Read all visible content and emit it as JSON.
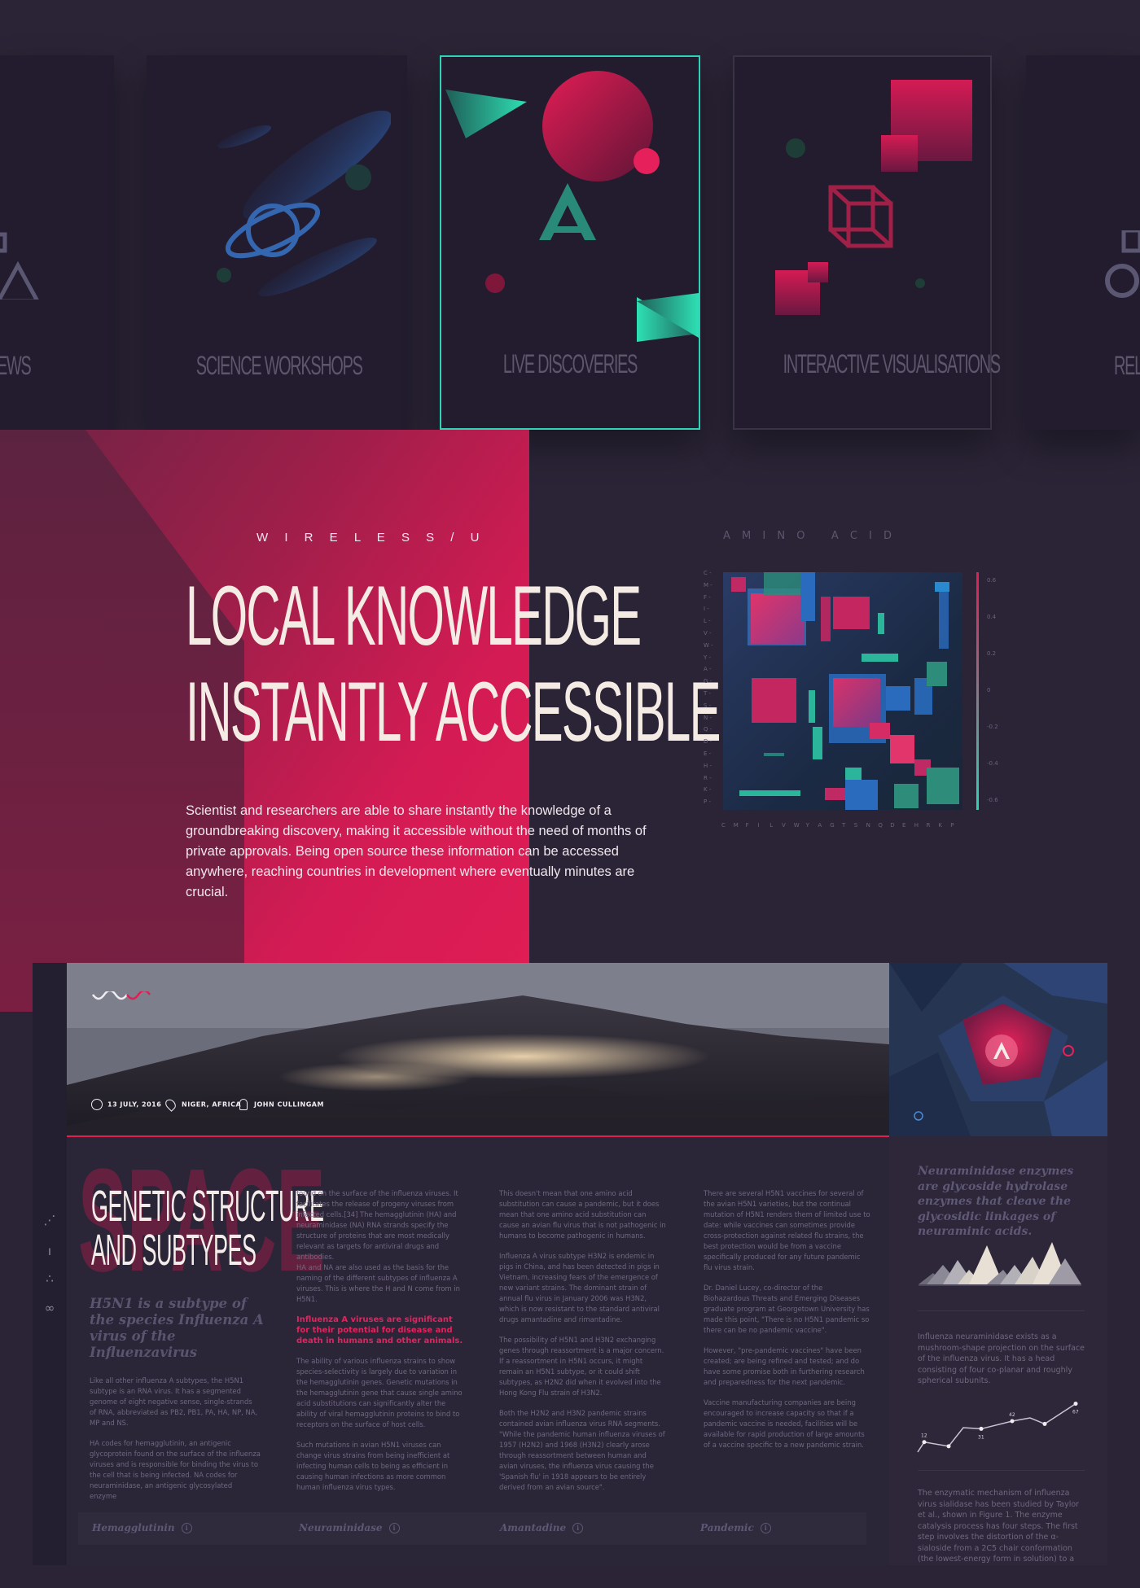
{
  "cards": [
    {
      "label": "EWS"
    },
    {
      "label": "SCIENCE WORKSHOPS"
    },
    {
      "label": "LIVE DISCOVERIES"
    },
    {
      "label": "INTERACTIVE VISUALISATIONS"
    },
    {
      "label": "REL"
    }
  ],
  "hero": {
    "eyebrow": "W I R E L E S S / U",
    "headline_line1": "LOCAL KNOWLEDGE",
    "headline_line2": "INSTANTLY ACCESSIBLE",
    "body": "Scientist and researchers are able to share instantly the knowledge of a groundbreaking discovery, making it accessible without the need of months of private approvals. Being open source these information can be accessed anywhere, reaching countries in development where eventually minutes are crucial."
  },
  "amino": {
    "title": "A M I N O   A C I D",
    "y_letters": [
      "C",
      "M",
      "F",
      "I",
      "L",
      "V",
      "W",
      "Y",
      "A",
      "G",
      "T",
      "S",
      "N",
      "Q",
      "D",
      "E",
      "H",
      "R",
      "K",
      "P"
    ],
    "x_letters": [
      "C",
      "M",
      "F",
      "I",
      "L",
      "V",
      "W",
      "Y",
      "A",
      "G",
      "T",
      "S",
      "N",
      "Q",
      "D",
      "E",
      "H",
      "R",
      "K",
      "P"
    ],
    "scale": [
      "0.6",
      "0.4",
      "0.2",
      "0",
      "-0.2",
      "-0.4",
      "-0.6"
    ]
  },
  "article": {
    "meta_date": "13 JULY, 2016",
    "meta_location": "NIGER, AFRICA",
    "meta_author": "JOHN CULLINGAM",
    "bg_word": "SPACE",
    "title_line1": "GENETIC STRUCTURE",
    "title_line2": "AND SUBTYPES",
    "subtitle": "H5N1 is a subtype of the species Influenza A virus of the Influenzavirus",
    "col1_p1": "Like all other influenza A subtypes, the H5N1 subtype is an RNA virus. It has a segmented genome of eight negative sense, single-strands of RNA, abbreviated as PB2, PB1, PA, HA, NP, NA, MP and NS.",
    "col1_p2": "HA codes for hemagglutinin, an antigenic glycoprotein found on the surface of the influenza viruses and is responsible for binding the virus to the cell that is being infected. NA codes for neuraminidase, an antigenic glycosylated enzyme",
    "col2_p1": "found on the surface of the influenza viruses. It facilitates the release of progeny viruses from infected cells.[34] The hemagglutinin (HA) and neuraminidase (NA) RNA strands specify the structure of proteins that are most medically relevant as targets for antiviral drugs and antibodies.",
    "col2_p1b": "HA and NA are also used as the basis for the naming of the different subtypes of influenza A viruses. This is where the H and N come from in H5N1.",
    "col2_highlight": "Influenza A viruses are significant for their potential for disease and death in humans and other animals.",
    "col2_p2": "The ability of various influenza strains to show species-selectivity is largely due to variation in the hemagglutinin genes. Genetic mutations in the hemagglutinin gene that cause single amino acid substitutions can significantly alter the ability of viral hemagglutinin proteins to bind to receptors on the surface of host cells.",
    "col2_p3": "Such mutations in avian H5N1 viruses can change virus strains from being inefficient at infecting human cells to being as efficient in causing human infections as more common human influenza virus types.",
    "col3_p1": "This doesn't mean that one amino acid substitution can cause a pandemic, but it does mean that one amino acid substitution can cause an avian flu virus that is not pathogenic in humans to become pathogenic in humans.",
    "col3_p2": "Influenza A virus subtype H3N2 is endemic in pigs in China, and has been detected in pigs in Vietnam, increasing fears of the emergence of new variant strains. The dominant strain of annual flu virus in January 2006 was H3N2, which is now resistant to the standard antiviral drugs amantadine and rimantadine.",
    "col3_p3": "The possibility of H5N1 and H3N2 exchanging genes through reassortment is a major concern. If a reassortment in H5N1 occurs, it might remain an H5N1 subtype, or it could shift subtypes, as H2N2 did when it evolved into the Hong Kong Flu strain of H3N2.",
    "col3_p4": "Both the H2N2 and H3N2 pandemic strains contained avian influenza virus RNA segments. \"While the pandemic human influenza viruses of 1957 (H2N2) and 1968 (H3N2) clearly arose through reassortment between human and avian viruses, the influenza virus causing the 'Spanish flu' in 1918 appears to be entirely derived from an avian source\".",
    "col4_p1": "There are several H5N1 vaccines for several of the avian H5N1 varieties, but the continual mutation of H5N1 renders them of limited use to date: while vaccines can sometimes provide cross-protection against related flu strains, the best protection would be from a vaccine specifically produced for any future pandemic flu virus strain.",
    "col4_p2": "Dr. Daniel Lucey, co-director of the Biohazardous Threats and Emerging Diseases graduate program at Georgetown University has made this point, \"There is no H5N1 pandemic so there can be no pandemic vaccine\".",
    "col4_p3": "However, \"pre-pandemic vaccines\" have been created; are being refined and tested; and do have some promise both in furthering research and preparedness for the next pandemic.",
    "col4_p4": "Vaccine manufacturing companies are being encouraged to increase capacity so that if a pandemic vaccine is needed, facilities will be available for rapid production of large amounts of a vaccine specific to a new pandemic strain.",
    "footer": [
      "Hemagglutinin",
      "Neuraminidase",
      "Amantadine",
      "Pandemic"
    ]
  },
  "side": {
    "quote": "Neuraminidase enzymes are glycoside hydrolase enzymes that cleave the glycosidic linkages of neuraminic acids.",
    "p1": "Influenza neuraminidase exists as a mushroom-shape projection on the surface of the influenza virus. It has a head consisting of four co-planar and roughly spherical subunits.",
    "p2": "The enzymatic mechanism of influenza virus sialidase has been studied by Taylor et al., shown in Figure 1. The enzyme catalysis process has four steps. The first step involves the distortion of the α-sialoside from a 2C5 chair conformation (the lowest-energy form in solution) to a"
  },
  "chart_data": {
    "type": "line",
    "values": [
      12,
      6,
      31,
      42,
      38,
      67
    ],
    "labels": [
      "12",
      "",
      "31",
      "42",
      "",
      "67"
    ]
  }
}
